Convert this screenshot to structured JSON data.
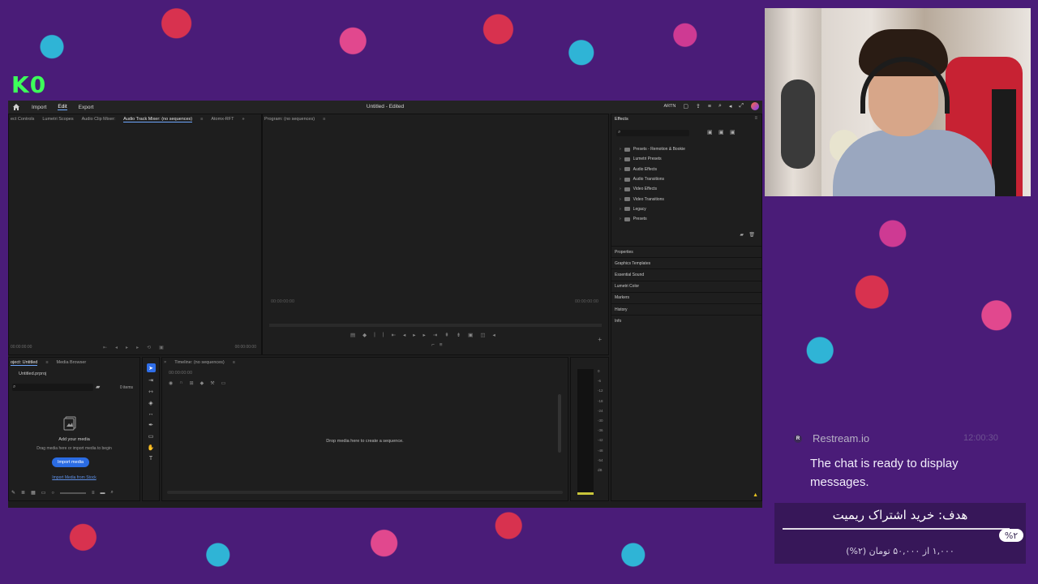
{
  "overlay": {
    "logo_text": "K0"
  },
  "premiere": {
    "menu": {
      "import": "Import",
      "edit": "Edit",
      "export": "Export"
    },
    "window_title": "Untitled - Edited",
    "top_right_label": "ARTN",
    "source_panel": {
      "tabs": [
        "ect Controls",
        "Lumetri Scopes",
        "Audio Clip Mixer:",
        "Audio Track Mixer: (no sequences)",
        "Atomx-RFT",
        "»"
      ],
      "timecode_left": "00:00:00:00",
      "timecode_right": "00:00:00:00"
    },
    "program_panel": {
      "title": "Program: (no sequences)",
      "timecode_left": "00:00:00:00",
      "timecode_right": "00:00:00:00"
    },
    "project_panel": {
      "tabs": [
        "oject: Untitled",
        "Media Browser"
      ],
      "file_name": "Untitled.prproj",
      "items_count": "0 items",
      "add_media": "Add your media",
      "drag_hint": "Drag media here or import media to begin",
      "import_button": "Import media",
      "stock_link": "Import Media from Stock"
    },
    "timeline_panel": {
      "title": "Timeline: (no sequences)",
      "timecode": "00:00:00:00",
      "drop_hint": "Drop media here to create a sequence."
    },
    "audio_meter": {
      "db_labels": [
        "0",
        "-6",
        "-12",
        "-18",
        "-24",
        "-30",
        "-36",
        "-42",
        "-48",
        "-54",
        "dB"
      ]
    },
    "effects_panel": {
      "title": "Effects",
      "items": [
        "Presets - Remotion & Bookie",
        "Lumetri Presets",
        "Audio Effects",
        "Audio Transitions",
        "Video Effects",
        "Video Transitions",
        "Legacy",
        "Presets"
      ]
    },
    "side_panels": [
      "Properties",
      "Graphics Templates",
      "Essential Sound",
      "Lumetri Color",
      "Markers",
      "History",
      "Info"
    ]
  },
  "chat": {
    "badge": "R",
    "sender": "Restream.io",
    "time": "12:00:30",
    "message": "The chat is ready to display messages."
  },
  "goal": {
    "title": "هدف: خرید اشتراک ریمیت",
    "percent_label": "%۲",
    "progress_fraction": 0.02,
    "amount_text": "۱,۰۰۰ از ۵۰,۰۰۰ تومان (۲%)"
  }
}
